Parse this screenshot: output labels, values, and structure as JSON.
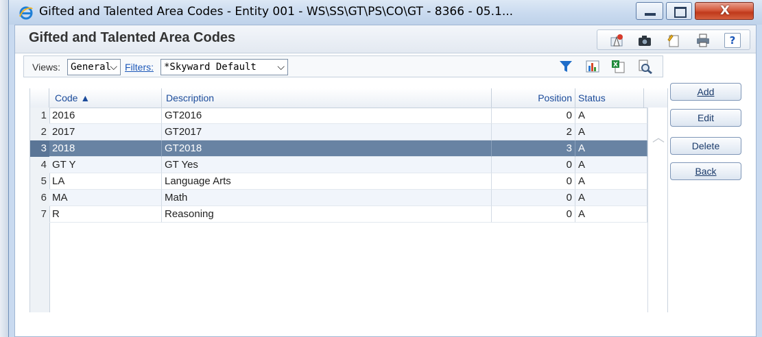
{
  "window": {
    "title": "Gifted and Talented Area Codes - Entity 001 - WS\\SS\\GT\\PS\\CO\\GT - 8366 - 05.1...",
    "close_label": "X"
  },
  "page": {
    "title": "Gifted and Talented Area Codes"
  },
  "header_tools": {
    "help_label": "?",
    "icons": [
      "alert-icon",
      "camera-icon",
      "notes-icon",
      "print-icon",
      "help-icon"
    ]
  },
  "toolbar": {
    "views_label": "Views:",
    "views_value": "General",
    "filters_label": "Filters:",
    "filters_value": "*Skyward Default",
    "icons": [
      "filter-icon",
      "chart-icon",
      "excel-export-icon",
      "print-preview-icon"
    ]
  },
  "actions": {
    "add": "Add",
    "edit": "Edit",
    "delete": "Delete",
    "back": "Back"
  },
  "grid": {
    "columns": {
      "code": "Code ▲",
      "description": "Description",
      "position": "Position",
      "status": "Status"
    },
    "rows": [
      {
        "num": "1",
        "code": "2016",
        "description": "GT2016",
        "position": "0",
        "status": "A"
      },
      {
        "num": "2",
        "code": "2017",
        "description": "GT2017",
        "position": "2",
        "status": "A"
      },
      {
        "num": "3",
        "code": "2018",
        "description": "GT2018",
        "position": "3",
        "status": "A"
      },
      {
        "num": "4",
        "code": "GT Y",
        "description": "GT Yes",
        "position": "0",
        "status": "A"
      },
      {
        "num": "5",
        "code": "LA",
        "description": "Language Arts",
        "position": "0",
        "status": "A"
      },
      {
        "num": "6",
        "code": "MA",
        "description": "Math",
        "position": "0",
        "status": "A"
      },
      {
        "num": "7",
        "code": "R",
        "description": "Reasoning",
        "position": "0",
        "status": "A"
      }
    ],
    "selected_row": 3
  },
  "colors": {
    "selected_row": "#6883a3",
    "link": "#1a56b8",
    "close_button": "#c0391b"
  }
}
